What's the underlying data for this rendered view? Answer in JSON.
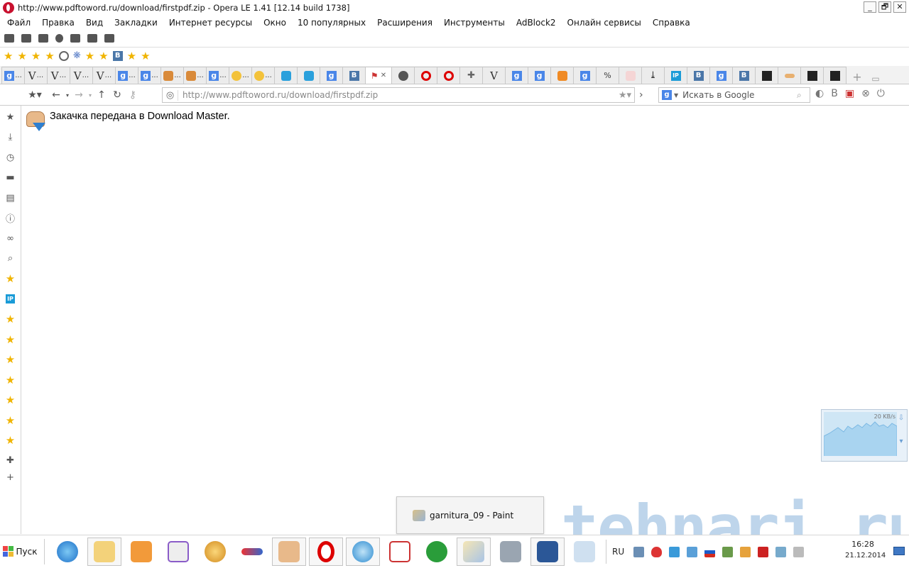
{
  "window": {
    "title": "http://www.pdftoword.ru/download/firstpdf.zip - Opera LE 1.41 [12.14 build 1738]",
    "controls": [
      "_",
      "🗗",
      "✕"
    ]
  },
  "menu": [
    "Файл",
    "Правка",
    "Вид",
    "Закладки",
    "Интернет ресурсы",
    "Окно",
    "10 популярных",
    "Расширения",
    "Инструменты",
    "AdBlock2",
    "Онлайн сервисы",
    "Справка"
  ],
  "tabs": [
    {
      "fav": "g",
      "dots": "..."
    },
    {
      "fav": "V",
      "dots": "..."
    },
    {
      "fav": "V",
      "dots": "..."
    },
    {
      "fav": "V",
      "dots": "..."
    },
    {
      "fav": "V",
      "dots": "..."
    },
    {
      "fav": "g",
      "dots": "..."
    },
    {
      "fav": "g",
      "dots": "..."
    },
    {
      "fav": "bm",
      "dots": "..."
    },
    {
      "fav": "bm",
      "dots": "..."
    },
    {
      "fav": "g",
      "dots": "..."
    },
    {
      "fav": "q",
      "dots": "..."
    },
    {
      "fav": "q",
      "dots": "..."
    },
    {
      "fav": "sky",
      "dots": ""
    },
    {
      "fav": "sky",
      "dots": ""
    },
    {
      "fav": "g",
      "dots": ""
    },
    {
      "fav": "b",
      "dots": ""
    },
    {
      "fav": "active",
      "dots": ""
    },
    {
      "fav": "skull",
      "dots": ""
    },
    {
      "fav": "o",
      "dots": ""
    },
    {
      "fav": "o",
      "dots": ""
    },
    {
      "fav": "puzzle",
      "dots": ""
    },
    {
      "fav": "V",
      "dots": ""
    },
    {
      "fav": "g",
      "dots": ""
    },
    {
      "fav": "g",
      "dots": ""
    },
    {
      "fav": "orange",
      "dots": ""
    },
    {
      "fav": "g",
      "dots": ""
    },
    {
      "fav": "sps",
      "dots": ""
    },
    {
      "fav": "ya",
      "dots": ""
    },
    {
      "fav": "dl",
      "dots": ""
    },
    {
      "fav": "ip",
      "dots": ""
    },
    {
      "fav": "b",
      "dots": ""
    },
    {
      "fav": "g",
      "dots": ""
    },
    {
      "fav": "b",
      "dots": ""
    },
    {
      "fav": "dark",
      "dots": ""
    },
    {
      "fav": "bar",
      "dots": ""
    },
    {
      "fav": "dark",
      "dots": ""
    },
    {
      "fav": "dark",
      "dots": ""
    }
  ],
  "address": {
    "url": "http://www.pdftoword.ru/download/firstpdf.zip"
  },
  "search": {
    "engine": "g",
    "placeholder": "Искать в Google"
  },
  "page": {
    "message": "Закачка передана в Download Master."
  },
  "speed_widget": {
    "label": "20 KB/s"
  },
  "popup": {
    "label": "garnitura_09 - Paint"
  },
  "watermark": "tehnari.ru",
  "taskbar": {
    "start_label": "Пуск",
    "language": "RU",
    "time": "16:28",
    "date": "21.12.2014"
  },
  "colors": {
    "accent": "#4a86e8",
    "opera_red": "#c8102e",
    "star": "#f0b400"
  }
}
